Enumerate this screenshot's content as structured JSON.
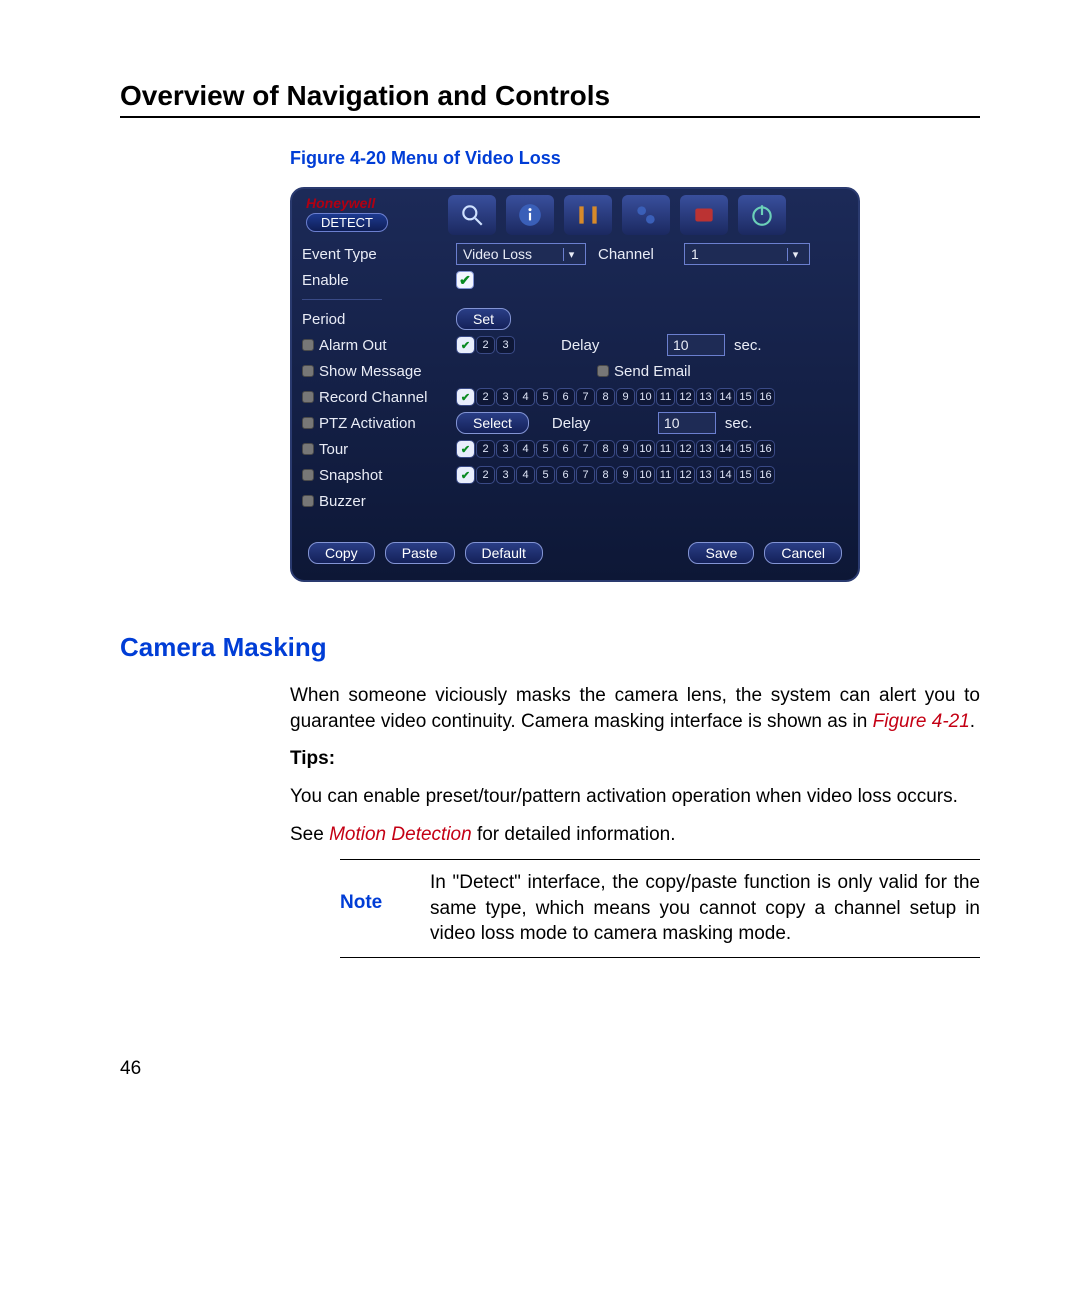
{
  "page": {
    "title": "Overview of Navigation and Controls",
    "figure_caption": "Figure 4-20 Menu of Video Loss",
    "page_number": "46"
  },
  "dvr": {
    "brand": "Honeywell",
    "category": "DETECT",
    "labels": {
      "event_type": "Event Type",
      "channel": "Channel",
      "enable": "Enable",
      "period": "Period",
      "alarm_out": "Alarm Out",
      "delay": "Delay",
      "sec": "sec.",
      "show_message": "Show Message",
      "send_email": "Send Email",
      "record_channel": "Record Channel",
      "ptz_activation": "PTZ Activation",
      "tour": "Tour",
      "snapshot": "Snapshot",
      "buzzer": "Buzzer"
    },
    "values": {
      "event_type": "Video Loss",
      "channel": "1",
      "alarm_delay": "10",
      "ptz_delay": "10",
      "alarm_out_chips": [
        "1",
        "2",
        "3"
      ],
      "ch16": [
        "1",
        "2",
        "3",
        "4",
        "5",
        "6",
        "7",
        "8",
        "9",
        "10",
        "11",
        "12",
        "13",
        "14",
        "15",
        "16"
      ]
    },
    "buttons": {
      "set": "Set",
      "select": "Select",
      "copy": "Copy",
      "paste": "Paste",
      "default": "Default",
      "save": "Save",
      "cancel": "Cancel"
    }
  },
  "section": {
    "heading": "Camera Masking",
    "para1_a": "When someone viciously masks the camera lens, the system can alert you to guarantee video continuity. Camera masking interface is shown as in ",
    "para1_ref": "Figure 4-21",
    "para1_b": ".",
    "tips_label": "Tips:",
    "tips_text": "You can enable preset/tour/pattern activation operation when video loss occurs.",
    "see_a": "See ",
    "see_link": "Motion Detection",
    "see_b": " for detailed information.",
    "note_label": "Note",
    "note_text": "In \"Detect\" interface, the copy/paste function is only valid for the same type, which means you cannot copy a channel setup in video loss mode to camera masking mode."
  }
}
